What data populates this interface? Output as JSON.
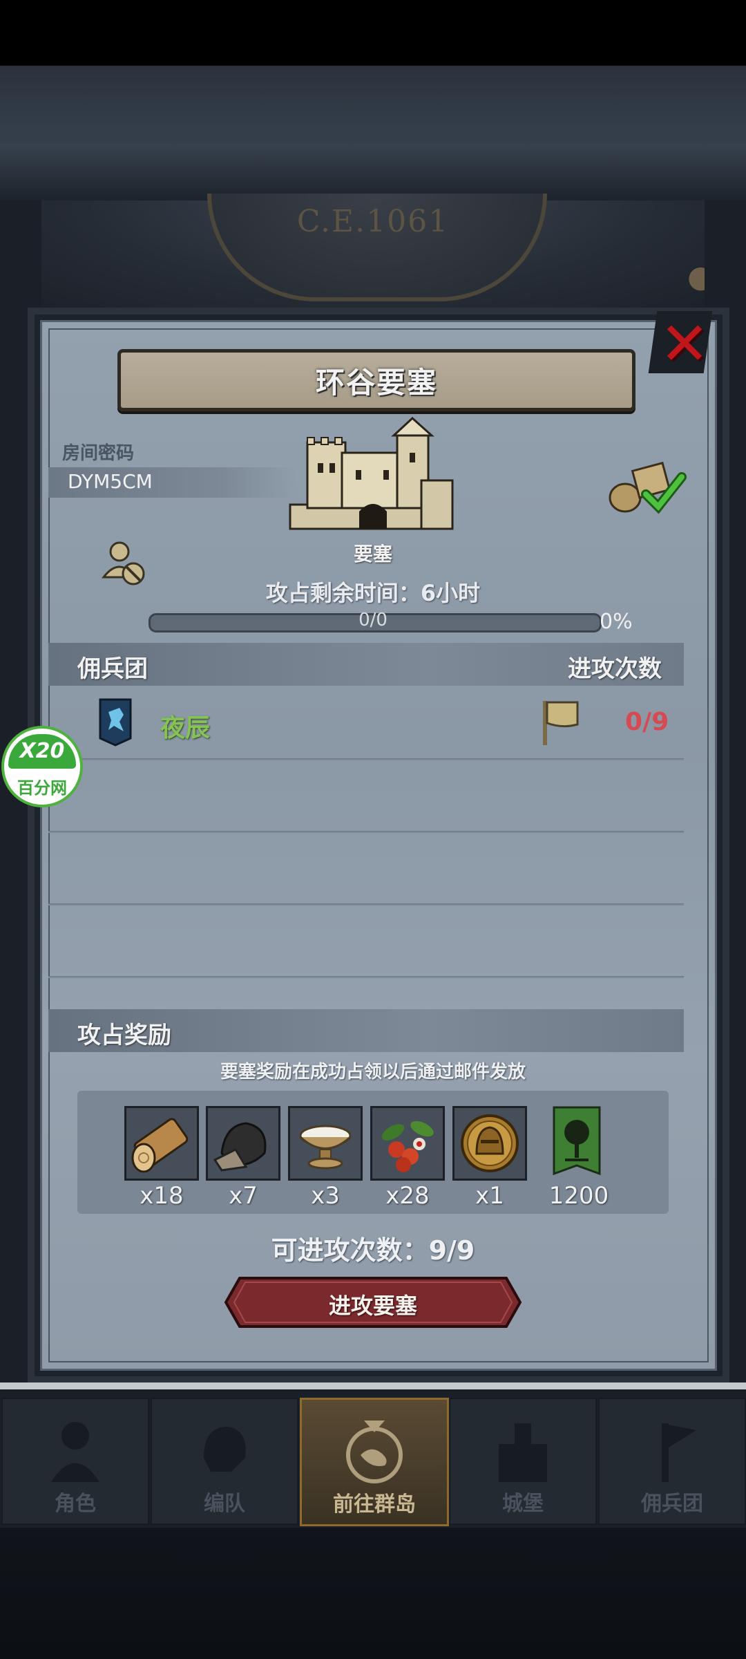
{
  "header": {
    "year_text": "C.E.1061"
  },
  "dialog": {
    "title": "环谷要塞",
    "room": {
      "label": "房间密码",
      "value": "DYM5CM"
    },
    "building_label": "要塞",
    "timer_text": "攻占剩余时间：6小时",
    "progress": {
      "text": "0/0",
      "percent_text": "0%",
      "fraction": 0
    },
    "mercenary_section": {
      "title": "佣兵团",
      "right_label": "进攻次数"
    },
    "mercenaries": [
      {
        "name": "夜辰",
        "attacks": "0/9",
        "name_color": "#84c354",
        "count_color": "#d64a52"
      }
    ],
    "reward_section": {
      "title": "攻占奖励",
      "note": "要塞奖励在成功占领以后通过邮件发放",
      "items": [
        {
          "icon": "wood-log-icon",
          "qty": "x18"
        },
        {
          "icon": "ore-icon",
          "qty": "x7"
        },
        {
          "icon": "salt-bowl-icon",
          "qty": "x3"
        },
        {
          "icon": "berries-icon",
          "qty": "x28"
        },
        {
          "icon": "helmet-coin-icon",
          "qty": "x1"
        },
        {
          "icon": "tree-banner-icon",
          "qty": "1200"
        }
      ]
    },
    "attack_count_text": "可进攻次数：9/9",
    "attack_button": "进攻要塞"
  },
  "bottom_nav": [
    {
      "label": "角色",
      "icon": "character-icon",
      "active": false
    },
    {
      "label": "编队",
      "icon": "formation-icon",
      "active": false
    },
    {
      "label": "前往群岛",
      "icon": "islands-icon",
      "active": true
    },
    {
      "label": "城堡",
      "icon": "castle-icon",
      "active": false
    },
    {
      "label": "佣兵团",
      "icon": "mercenary-icon",
      "active": false
    }
  ],
  "watermark": {
    "top": "X20",
    "bottom": "百分网"
  },
  "colors": {
    "accent_green": "#84c354",
    "count_red": "#d64a52",
    "close_red": "#c0151b",
    "button_red": "#7a2a2c"
  }
}
